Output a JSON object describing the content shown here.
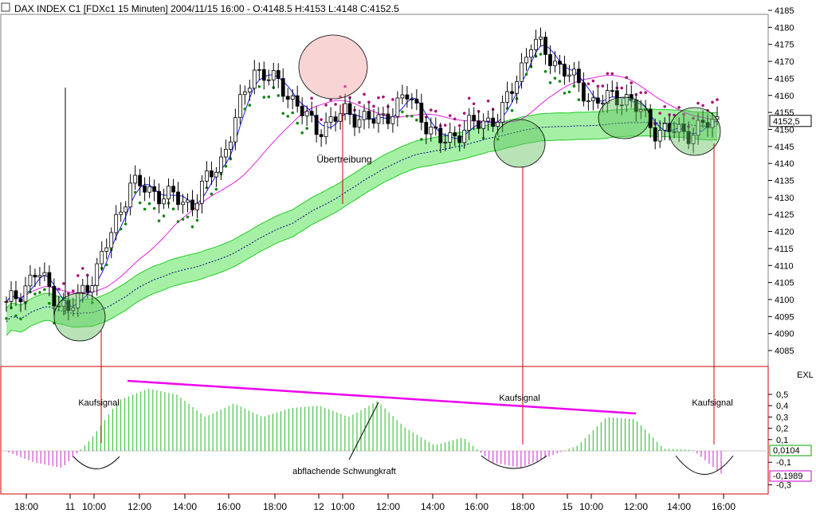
{
  "window": {
    "title_bar": "DAX INDEX C1 [FDXc1  15 Minuten] 2004/11/15 16:00 - O:4148.5 H:4153 L:4148 C:4152.5"
  },
  "chart_data": [
    {
      "type": "candlestick",
      "title": "DAX INDEX C1 [FDXc1  15 Minuten] 2004/11/15 16:00 - O:4148.5 H:4153 L:4148 C:4152.5",
      "ylim": [
        4080,
        4187
      ],
      "y_ticks": [
        4085,
        4090,
        4095,
        4100,
        4105,
        4110,
        4115,
        4120,
        4125,
        4130,
        4135,
        4140,
        4145,
        4150,
        4155,
        4160,
        4165,
        4170,
        4175,
        4180,
        4185
      ],
      "last_price_label": "4152,5",
      "x_tick_labels": [
        "18:00",
        "11",
        "10:00",
        "12:00",
        "14:00",
        "16:00",
        "18:00",
        "12",
        "10:00",
        "12:00",
        "14:00",
        "16:00",
        "18:00",
        "15",
        "10:00",
        "12:00",
        "14:00",
        "16:00"
      ],
      "key_closes": [
        4098,
        4108,
        4096,
        4110,
        4134,
        4131,
        4128,
        4142,
        4168,
        4162,
        4150,
        4155,
        4152,
        4160,
        4146,
        4151,
        4154,
        4176,
        4168,
        4158,
        4160,
        4150,
        4149,
        4152.5
      ],
      "annotations": [
        "Übertreibung"
      ],
      "overlays": [
        "fast moving average (blue)",
        "slow moving average (magenta)",
        "moving average envelope band (green)",
        "parabolic SAR (purple/green dots)"
      ]
    },
    {
      "type": "bar",
      "title": "EXL",
      "ylim": [
        -0.35,
        0.65
      ],
      "y_ticks": [
        "0,5",
        "0,4",
        "0,3",
        "0,2",
        "0,1",
        "-0,1",
        "-0,3"
      ],
      "value_labels": [
        "0,0104",
        "-0,1989"
      ],
      "annotations": [
        "Kaufsignal",
        "Kaufsignal",
        "Kaufsignal",
        "abflachende Schwungkraft"
      ],
      "key_values": [
        0.0,
        -0.1,
        -0.15,
        0.1,
        0.45,
        0.55,
        0.5,
        0.3,
        0.42,
        0.3,
        0.38,
        0.4,
        0.3,
        0.44,
        0.2,
        0.05,
        0.12,
        -0.1,
        -0.15,
        -0.05,
        0.05,
        0.3,
        0.28,
        0.02,
        0.01,
        -0.2
      ]
    }
  ]
}
